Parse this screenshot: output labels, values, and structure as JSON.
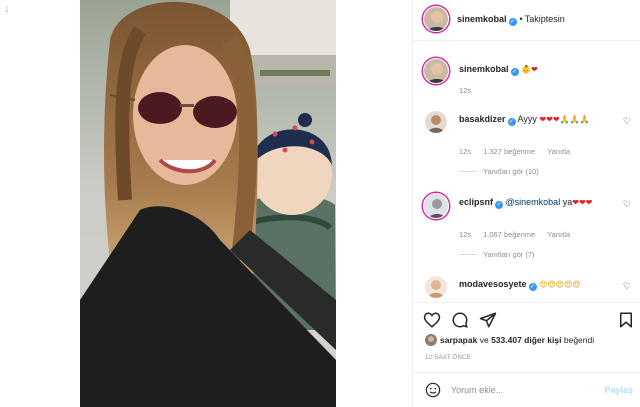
{
  "page": {
    "back_glyph": "↓"
  },
  "header": {
    "username": "sinemkobal",
    "separator": "•",
    "follow_status": "Takiptesin"
  },
  "caption": {
    "username": "sinemkobal",
    "emojis": "👶❤",
    "time": "12s"
  },
  "comments": [
    {
      "username": "basakdizer",
      "text": "Ayyy",
      "emojis": "❤❤❤🙏🙏🙏",
      "time": "12s",
      "likes": "1.327 beğenme",
      "reply_label": "Yanıtla",
      "view_replies": "Yanıtları gör (10)"
    },
    {
      "username": "eclipsnf",
      "mention": "@sinemkobal",
      "text": "ya",
      "emojis": "❤❤❤",
      "time": "12s",
      "likes": "1.067 beğenme",
      "reply_label": "Yanıtla",
      "view_replies": "Yanıtları gör (7)"
    },
    {
      "username": "modavesosyete",
      "emojis": "😍😍😍😍😍"
    }
  ],
  "likes": {
    "first_user": "sarpapak",
    "connector": "ve",
    "others": "533.407 diğer kişi",
    "suffix": "beğendi"
  },
  "timeago": "12 SAAT ÖNCE",
  "add_comment": {
    "placeholder": "Yorum ekle...",
    "post_label": "Paylaş"
  },
  "colors": {
    "verified": "#3897f0",
    "mention": "#00376b",
    "muted": "#8e8e8e",
    "story_ring": "#d6249f",
    "post_disabled": "#b2dffc"
  }
}
